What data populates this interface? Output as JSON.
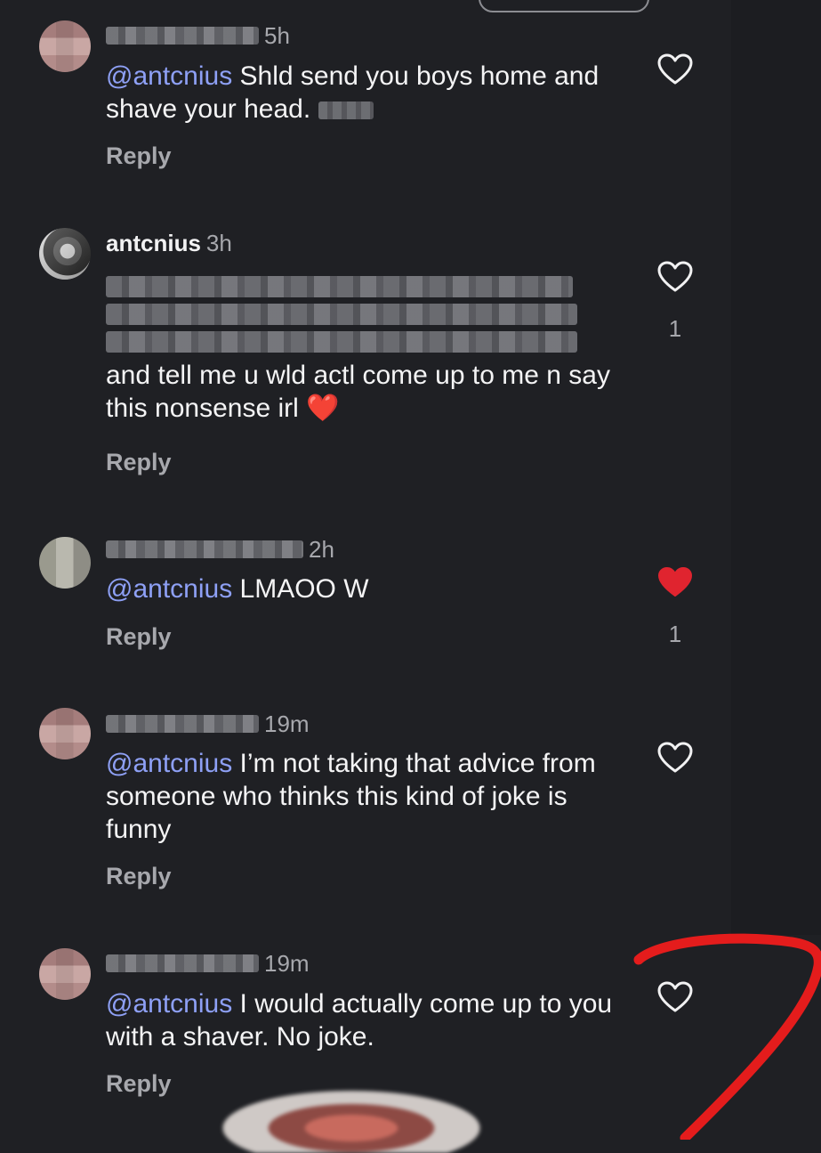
{
  "comments": [
    {
      "username": "",
      "time": "5h",
      "mention": "@antcnius",
      "text": " Shld send you boys home and shave your head. ",
      "reply": "Reply",
      "liked": false,
      "likes": ""
    },
    {
      "username": "antcnius",
      "time": "3h",
      "mention": "",
      "text": "and tell me u wld actl come up to me n say this nonsense irl",
      "emoji": "❤️",
      "reply": "Reply",
      "liked": false,
      "likes": "1"
    },
    {
      "username": "",
      "time": "2h",
      "mention": "@antcnius",
      "text": " LMAOO W",
      "reply": "Reply",
      "liked": true,
      "likes": "1"
    },
    {
      "username": "",
      "time": "19m",
      "mention": "@antcnius",
      "text": " I’m not taking that advice from someone who thinks this kind of joke is funny",
      "reply": "Reply",
      "liked": false,
      "likes": ""
    },
    {
      "username": "",
      "time": "19m",
      "mention": "@antcnius",
      "text": " I would actually come up to you with a shaver. No joke.",
      "reply": "Reply",
      "liked": false,
      "likes": ""
    }
  ],
  "colors": {
    "background": "#1f2024",
    "mention": "#8ea0f5",
    "liked_heart": "#e0242f",
    "annotation": "#e41c1c"
  },
  "icons": {
    "like": "heart-outline-icon",
    "liked": "heart-filled-icon"
  }
}
